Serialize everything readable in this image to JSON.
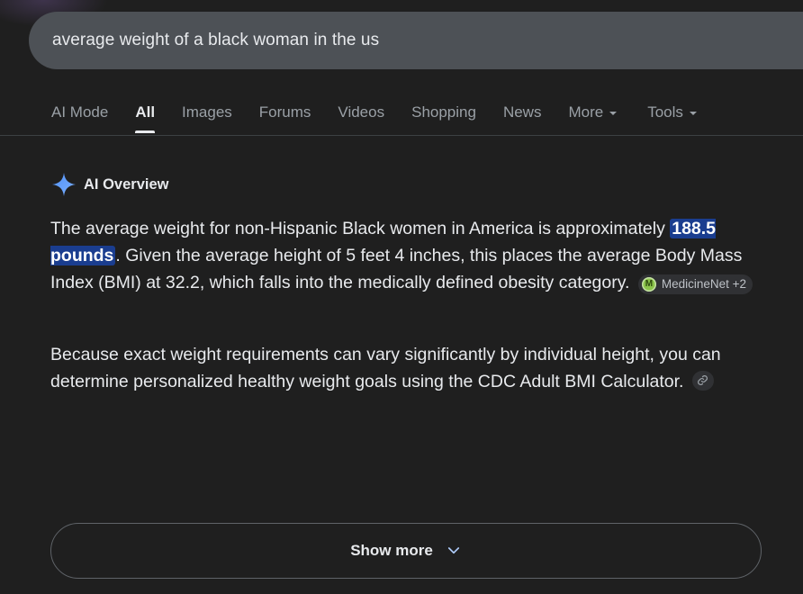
{
  "search": {
    "query": "average weight of a black woman in the us"
  },
  "tabs": [
    {
      "label": "AI Mode",
      "active": false
    },
    {
      "label": "All",
      "active": true
    },
    {
      "label": "Images",
      "active": false
    },
    {
      "label": "Forums",
      "active": false
    },
    {
      "label": "Videos",
      "active": false
    },
    {
      "label": "Shopping",
      "active": false
    },
    {
      "label": "News",
      "active": false
    },
    {
      "label": "More",
      "active": false,
      "dropdown": true
    }
  ],
  "tools": {
    "label": "Tools",
    "dropdown": true
  },
  "ai_overview": {
    "title": "AI Overview",
    "icon": "sparkle-icon",
    "paragraph1": {
      "before": "The average weight for non-Hispanic Black women in America is approximately ",
      "highlight": "188.5 pounds",
      "after": ". Given the average height of 5 feet 4 inches, this places the average Body Mass Index (BMI) at 32.2, which falls into the medically defined obesity category.",
      "source": {
        "logo_letter": "M",
        "label": "MedicineNet +2"
      }
    },
    "paragraph2": {
      "text": "Because exact weight requirements can vary significantly by individual height, you can determine personalized healthy weight goals using the CDC Adult BMI Calculator.",
      "link_icon": "link-icon"
    }
  },
  "show_more": {
    "label": "Show more",
    "icon": "chevron-down-icon"
  },
  "colors": {
    "background": "#1f1f1f",
    "search_box": "#4d5156",
    "highlight_bg": "#1a3d8f",
    "sparkle": "#4f8ff7"
  }
}
